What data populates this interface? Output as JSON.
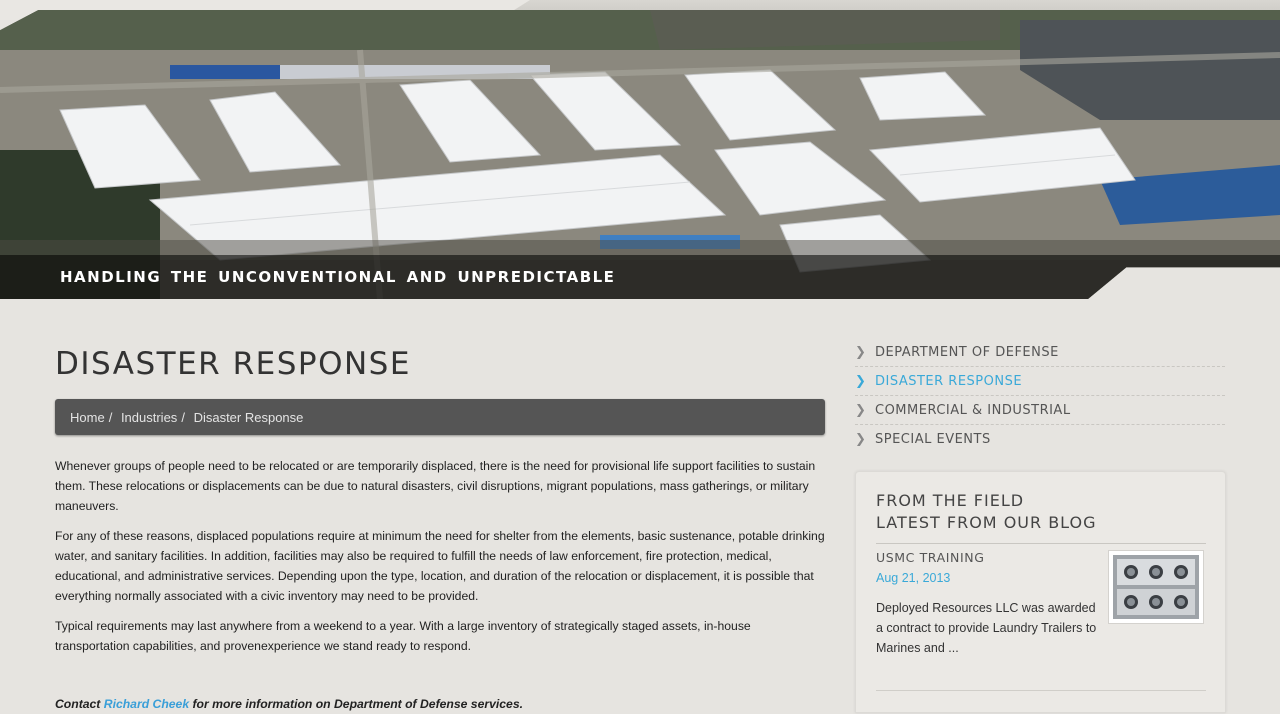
{
  "hero": {
    "tagline": "HANDLING THE UNCONVENTIONAL AND UNPREDICTABLE"
  },
  "page": {
    "title": "DISASTER RESPONSE"
  },
  "breadcrumb": {
    "items": [
      "Home",
      "Industries",
      "Disaster Response"
    ],
    "separator": "/"
  },
  "content": {
    "paragraphs": [
      "Whenever groups of people need to be relocated or are temporarily displaced, there is the need for provisional life support facilities to sustain them. These relocations or displacements can be due to natural disasters, civil disruptions, migrant populations, mass gatherings, or military maneuvers.",
      "For any of these reasons, displaced populations require at minimum the need for shelter from the elements, basic sustenance, potable drinking water, and sanitary facilities. In addition, facilities may also be required to fulfill the needs of law enforcement, fire protection, medical, educational, and administrative services. Depending upon the type, location, and duration of the relocation or displacement, it is possible that everything normally associated with a civic inventory may need to be provided.",
      "Typical requirements may last anywhere from a weekend to a year. With a large inventory of strategically staged assets, in-house transportation capabilities, and provenexperience we stand ready to respond."
    ],
    "contact_prefix": "Contact",
    "contact_name": "Richard Cheek",
    "contact_suffix": "for more information on Department of Defense services."
  },
  "sidebar": {
    "nav": [
      {
        "label": "DEPARTMENT OF DEFENSE",
        "active": false
      },
      {
        "label": "DISASTER RESPONSE",
        "active": true
      },
      {
        "label": "COMMERCIAL & INDUSTRIAL",
        "active": false
      },
      {
        "label": "SPECIAL EVENTS",
        "active": false
      }
    ],
    "blog": {
      "heading_line1": "FROM THE FIELD",
      "heading_line2": "LATEST FROM OUR BLOG",
      "post": {
        "title": "USMC TRAINING",
        "date": "Aug 21, 2013",
        "excerpt": "Deployed Resources LLC was awarded a contract to provide Laundry Trailers to Marines and ..."
      }
    }
  },
  "colors": {
    "accent": "#3aa9d8",
    "breadcrumb_bg": "#555555",
    "page_bg": "#e6e4e0"
  }
}
